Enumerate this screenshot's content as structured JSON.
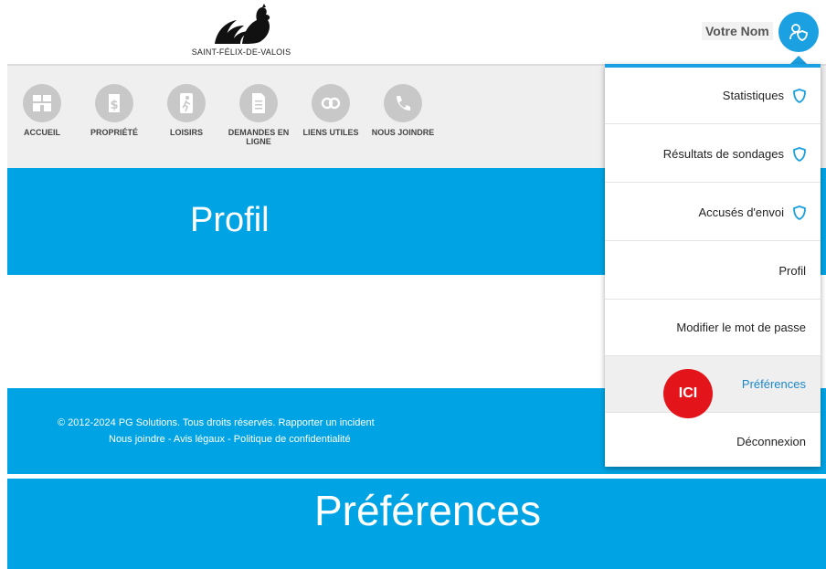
{
  "header": {
    "logo_text": "SAINT-FÉLIX-DE-VALOIS",
    "user_name": "Votre Nom"
  },
  "nav": {
    "items": [
      {
        "label": "ACCUEIL",
        "icon": "home-icon"
      },
      {
        "label": "PROPRIÉTÉ",
        "icon": "dollar-tag-icon"
      },
      {
        "label": "LOISIRS",
        "icon": "leisure-icon"
      },
      {
        "label": "DEMANDES EN LIGNE",
        "icon": "document-icon"
      },
      {
        "label": "LIENS UTILES",
        "icon": "link-icon"
      },
      {
        "label": "NOUS JOINDRE",
        "icon": "phone-icon"
      }
    ]
  },
  "profil": {
    "title": "Profil"
  },
  "footer": {
    "copyright": "© 2012-2024 PG Solutions. Tous droits réservés. Rapporter un incident",
    "links": "Nous joindre - Avis légaux - Politique de confidentialité"
  },
  "preferences_banner": {
    "title": "Préférences"
  },
  "dropdown": {
    "items": [
      {
        "label": "Statistiques",
        "icon": "shield-icon"
      },
      {
        "label": "Résultats de sondages",
        "icon": "shield-icon"
      },
      {
        "label": "Accusés d'envoi",
        "icon": "shield-icon"
      },
      {
        "label": "Profil"
      },
      {
        "label": "Modifier le mot de passe"
      },
      {
        "label": "Préférences",
        "active": true
      },
      {
        "label": "Déconnexion"
      }
    ],
    "badge": "ICI"
  },
  "colors": {
    "primary_blue": "#00a4e4",
    "accent_blue": "#1ba0e2",
    "badge_red": "#e4141b",
    "active_text": "#1b87c9"
  }
}
